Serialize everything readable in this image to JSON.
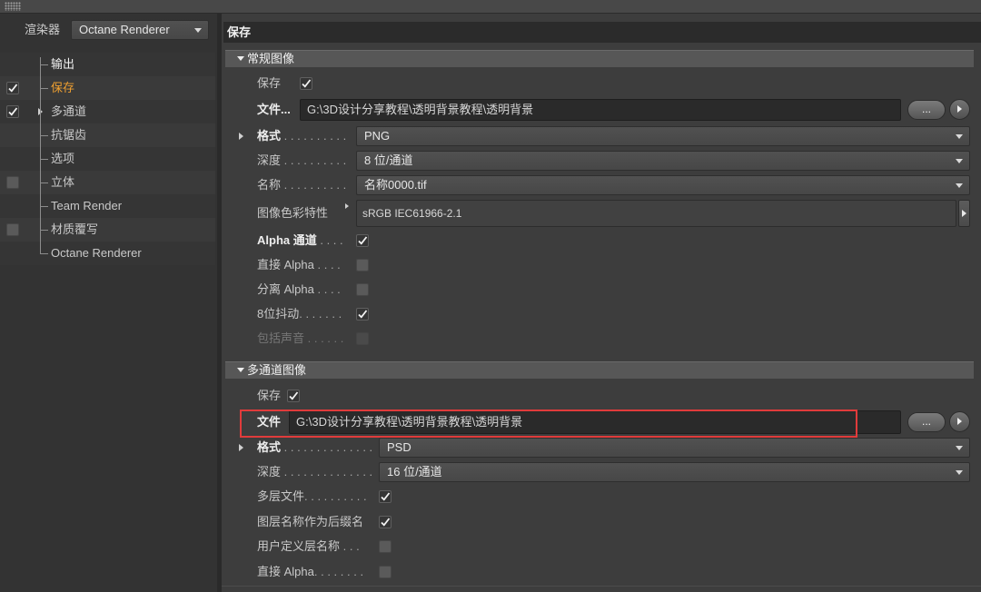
{
  "sidebar": {
    "renderer_label": "渲染器",
    "renderer_value": "Octane Renderer",
    "items": [
      {
        "label": "输出",
        "checked": null,
        "selected": false
      },
      {
        "label": "保存",
        "checked": true,
        "selected": true
      },
      {
        "label": "多通道",
        "checked": true,
        "selected": false,
        "expandable": true
      },
      {
        "label": "抗锯齿",
        "checked": null,
        "selected": false
      },
      {
        "label": "选项",
        "checked": null,
        "selected": false
      },
      {
        "label": "立体",
        "checked": false,
        "selected": false
      },
      {
        "label": "Team Render",
        "checked": null,
        "selected": false
      },
      {
        "label": "材质覆写",
        "checked": false,
        "selected": false
      },
      {
        "label": "Octane Renderer",
        "checked": null,
        "selected": false
      }
    ]
  },
  "panel": {
    "title": "保存",
    "regular": {
      "section_label": "常规图像",
      "save": {
        "label": "保存",
        "checked": true
      },
      "file": {
        "label": "文件...",
        "value": "G:\\3D设计分享教程\\透明背景教程\\透明背景",
        "browse_label": "..."
      },
      "format": {
        "label": "格式",
        "leader": ". . . . . . . . . .",
        "value": "PNG"
      },
      "depth": {
        "label": "深度",
        "leader": ". . . . . . . . . .",
        "value": "8 位/通道"
      },
      "name": {
        "label": "名称",
        "leader": ". . . . . . . . . .",
        "value": "名称0000.tif"
      },
      "color_profile": {
        "label": "图像色彩特性",
        "value": "sRGB IEC61966-2.1"
      },
      "alpha_channel": {
        "label": "Alpha 通道",
        "leader": ". . . .",
        "checked": true
      },
      "straight_alpha": {
        "label": "直接 Alpha",
        "leader": ". . . .",
        "checked": false
      },
      "separate_alpha": {
        "label": "分离 Alpha",
        "leader": ". . . .",
        "checked": false
      },
      "dither_8bit": {
        "label": "8位抖动",
        "leader": ". . . . . . .",
        "checked": true
      },
      "include_sound": {
        "label": "包括声音",
        "leader": ". . . . . .",
        "checked": false,
        "disabled": true
      }
    },
    "multipass": {
      "section_label": "多通道图像",
      "save": {
        "label": "保存",
        "checked": true
      },
      "file": {
        "label": "文件",
        "value": "G:\\3D设计分享教程\\透明背景教程\\透明背景",
        "browse_label": "..."
      },
      "format": {
        "label": "格式",
        "leader": ". . . . . . . . . . . . . .",
        "value": "PSD"
      },
      "depth": {
        "label": "深度",
        "leader": ". . . . . . . . . . . . . .",
        "value": "16 位/通道"
      },
      "multilayer": {
        "label": "多层文件",
        "leader": ". . . . . . . . . .",
        "checked": true
      },
      "layer_name_suffix": {
        "label": "图层名称作为后缀名",
        "checked": true
      },
      "user_layer_name": {
        "label": "用户定义层名称",
        "leader": ". . .",
        "checked": false
      },
      "straight_alpha": {
        "label": "直接 Alpha",
        "leader": ". . . . . . . .",
        "checked": false
      }
    }
  },
  "colors": {
    "selected_item": "#f0a030",
    "highlight_box": "#e03b3b"
  }
}
